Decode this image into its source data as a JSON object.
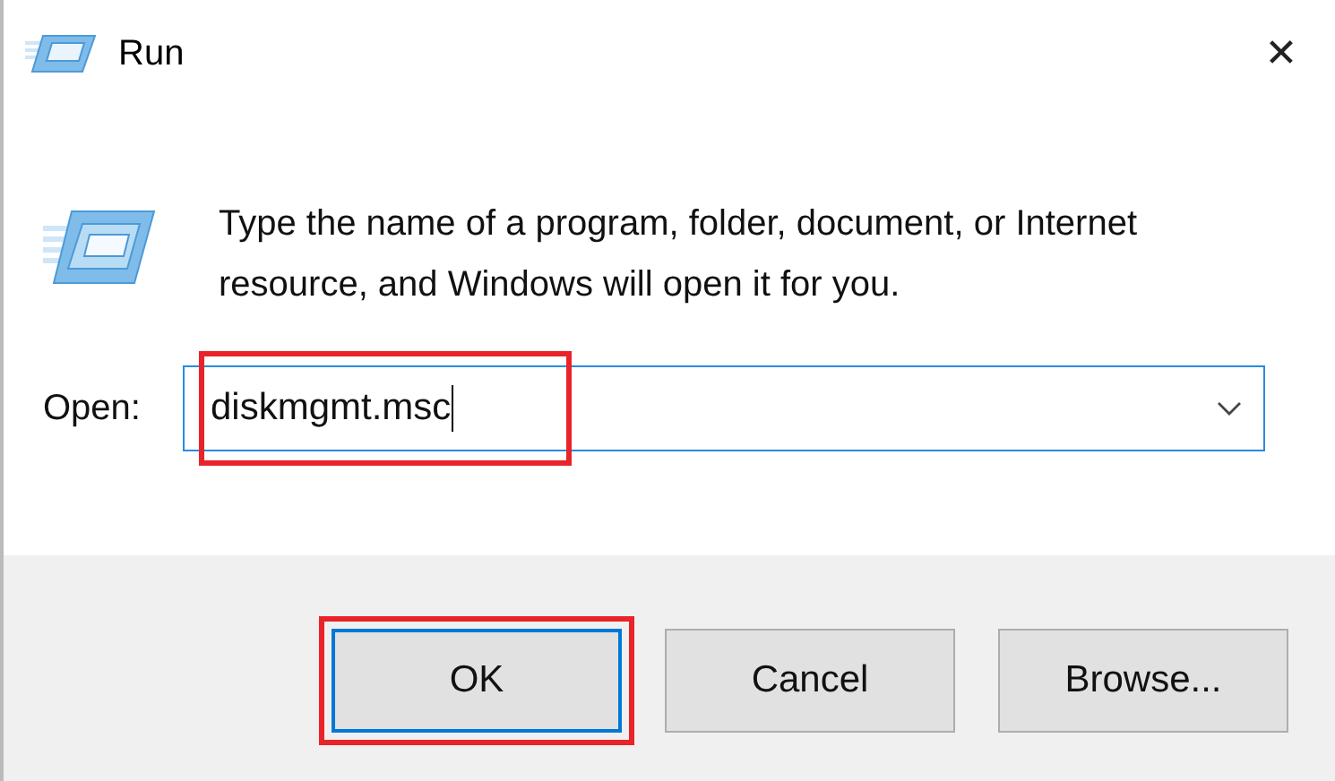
{
  "window": {
    "title": "Run",
    "close": "✕"
  },
  "description": "Type the name of a program, folder, document, or Internet resource, and Windows will open it for you.",
  "open_field": {
    "label": "Open:",
    "value": "diskmgmt.msc",
    "highlighted": true
  },
  "buttons": [
    {
      "label": "OK",
      "default": true,
      "highlighted": true
    },
    {
      "label": "Cancel",
      "default": false,
      "highlighted": false
    },
    {
      "label": "Browse...",
      "default": false,
      "highlighted": false
    }
  ]
}
